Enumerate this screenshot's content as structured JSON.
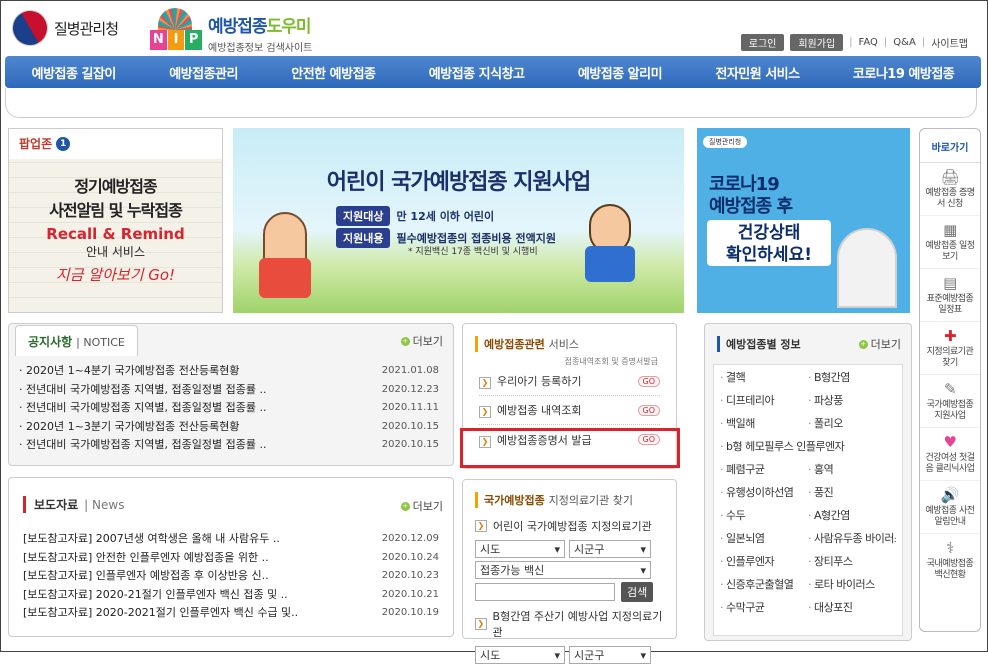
{
  "header": {
    "kdca_logo": "질병관리청",
    "nip_letters": [
      "N",
      "I",
      "P"
    ],
    "site_title_a": "예방접종",
    "site_title_b": "도우미",
    "site_subtitle": "예방접종정보 검색사이트",
    "util": {
      "login": "로그인",
      "join": "회원가입",
      "faq": "FAQ",
      "qna": "Q&A",
      "sitemap": "사이트맵"
    }
  },
  "gnb": [
    "예방접종 길잡이",
    "예방접종관리",
    "안전한 예방접종",
    "예방접종 지식창고",
    "예방접종 알리미",
    "전자민원 서비스",
    "코로나19 예방접종"
  ],
  "popup": {
    "title": "팝업존",
    "count": "1",
    "line1": "정기예방접종",
    "line2": "사전알림 및 누락접종",
    "line3": "Recall & Remind",
    "line4": "안내 서비스",
    "line5": "지금 알아보기 Go!"
  },
  "banner": {
    "title": "어린이 국가예방접종 지원사업",
    "tag1": "지원대상",
    "text1": "만 12세 이하 어린이",
    "tag2": "지원내용",
    "text2": "필수예방접종의 접종비용 전액지원",
    "note": "* 지원백신 17종 백신비 및 시행비"
  },
  "covid": {
    "org": "질병관리청",
    "l1": "코로나19",
    "l2": "예방접종 후",
    "l3": "건강상태",
    "l4": "확인하세요!"
  },
  "quick": {
    "title": "바로가기",
    "items": [
      {
        "icon": "printer-icon",
        "glyph": "🖨",
        "label": "예방접종 증명서 신청"
      },
      {
        "icon": "calendar-icon",
        "glyph": "▦",
        "label": "예방접종 일정보기"
      },
      {
        "icon": "schedule-icon",
        "glyph": "▤",
        "label": "표준예방접종 일정표"
      },
      {
        "icon": "hospital-icon",
        "glyph": "✚",
        "label": "지정의료기관 찾기"
      },
      {
        "icon": "document-icon",
        "glyph": "✎",
        "label": "국가예방접종 지원사업"
      },
      {
        "icon": "clinic-icon",
        "glyph": "♥",
        "label": "건강여성 첫걸음 클리닉사업"
      },
      {
        "icon": "speaker-icon",
        "glyph": "🔊",
        "label": "예방접종 사전알림안내"
      },
      {
        "icon": "vaccine-icon",
        "glyph": "⚕",
        "label": "국내예방접종 백신현황"
      }
    ]
  },
  "notice": {
    "tab": "공지사항",
    "tab_sub": "NOTICE",
    "more": "더보기",
    "items": [
      {
        "title": "· 2020년 1~4분기 국가예방접종 전산등록현황",
        "date": "2021.01.08"
      },
      {
        "title": "· 전년대비 국가예방접종 지역별, 접종일정별 접종률 ..",
        "date": "2020.12.23"
      },
      {
        "title": "· 전년대비 국가예방접종 지역별, 접종일정별 접종률 ..",
        "date": "2020.11.11"
      },
      {
        "title": "· 2020년 1~3분기 국가예방접종 전산등록현황",
        "date": "2020.10.15"
      },
      {
        "title": "· 전년대비 국가예방접종 지역별, 접종일정별 접종률 ..",
        "date": "2020.10.15"
      }
    ]
  },
  "press": {
    "tab": "보도자료",
    "tab_sub": "News",
    "more": "더보기",
    "items": [
      {
        "title": "[보도참고자료] 2007년생 여학생은 올해 내 사람유두 ..",
        "date": "2020.12.09"
      },
      {
        "title": "[보도참고자료] 안전한 인플루엔자 예방접종을 위한 ..",
        "date": "2020.10.24"
      },
      {
        "title": "[보도참고자료] 인플루엔자 예방접종 후 이상반응 신..",
        "date": "2020.10.23"
      },
      {
        "title": "[보도참고자료] 2020-21절기 인플루엔자 백신 접종 및 ..",
        "date": "2020.10.21"
      },
      {
        "title": "[보도참고자료] 2020-2021절기 인플루엔자 백신 수급 및..",
        "date": "2020.10.19"
      }
    ]
  },
  "service": {
    "title_a": "예방접종관련",
    "title_b": "서비스",
    "subtitle": "접종내역조회 및 증명서발급",
    "items": [
      {
        "label": "우리아기 등록하기",
        "go": "GO"
      },
      {
        "label": "예방접종 내역조회",
        "go": "GO"
      },
      {
        "label": "예방접종증명서 발급",
        "go": "GO"
      }
    ]
  },
  "clinic": {
    "title_a": "국가예방접종",
    "title_b": "지정의료기관 찾기",
    "sub1": "어린이 국가예방접종 지정의료기관",
    "sido": "시도",
    "sigungu": "시군구",
    "vaccine": "접종가능 백신",
    "search": "검색",
    "sub2": "B형간염 주산기 예방사업 지정의료기관",
    "sido2": "시도",
    "sigungu2": "시군구"
  },
  "vaccine_info": {
    "title": "예방접종별 정보",
    "more": "더보기",
    "items": [
      "결핵",
      "B형간염",
      "디프테리아",
      "파상풍",
      "백일해",
      "폴리오",
      "b형 헤모필루스 인플루엔자",
      "",
      "폐렴구균",
      "홍역",
      "유행성이하선염",
      "풍진",
      "수두",
      "A형간염",
      "일본뇌염",
      "",
      "사람유두종 바이러스",
      "",
      "인플루엔자",
      "장티푸스",
      "신증후군출혈열",
      "로타 바이러스",
      "수막구균",
      "대상포진"
    ]
  }
}
